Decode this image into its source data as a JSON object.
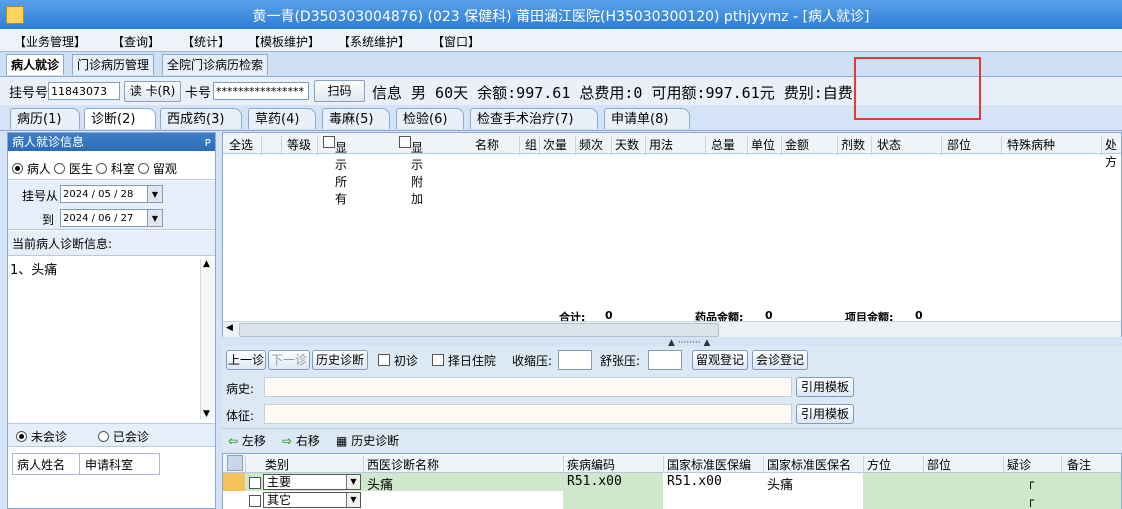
{
  "window": {
    "title": "黄一青(D350303004876) (023 保健科) 莆田涵江医院(H35030300120) pthjyymz - [病人就诊]"
  },
  "menu": [
    "【业务管理】",
    "【查询】",
    "【统计】",
    "【模板维护】",
    "【系统维护】",
    "【窗口】"
  ],
  "page_tabs": [
    "病人就诊",
    "门诊病历管理",
    "全院门诊病历检索"
  ],
  "patient": {
    "reg_label": "挂号号",
    "reg_no": "11843073",
    "read_card_label": "读 卡(R)",
    "card_label": "卡号",
    "card_no": "****************",
    "scan_label": "扫码",
    "info_text": "信息 男 60天 余额:997.61 总费用:0 可用额:997.61元 费别:自费"
  },
  "sub_tabs": [
    "病历(1)",
    "诊断(2)",
    "西成药(3)",
    "草药(4)",
    "毒麻(5)",
    "检验(6)",
    "检查手术治疗(7)",
    "申请单(8)"
  ],
  "left_panel": {
    "title": "病人就诊信息",
    "pin": "ᴘ",
    "radio_options": [
      "病人",
      "医生",
      "科室",
      "留观"
    ],
    "date_from_label": "挂号从",
    "date_from": "2024 / 05 / 28",
    "date_to_label": "到",
    "date_to": "2024 / 06 / 27",
    "current_diag_label": "当前病人诊断信息:",
    "current_diag": "1、头痛",
    "consult_options": [
      "未会诊",
      "已会诊"
    ],
    "consult_table_headers": [
      "病人姓名",
      "申请科室"
    ]
  },
  "order_grid": {
    "headers": [
      "全选",
      "等级",
      "显示所有",
      "显示附加",
      "名称",
      "组",
      "次量",
      "频次",
      "天数",
      "用法",
      "总量",
      "单位",
      "金额",
      "剂数",
      "状态",
      "部位",
      "特殊病种",
      "处方"
    ],
    "total_label": "合计:",
    "total_value": "0",
    "drug_amount_label": "药品金额:",
    "drug_amount_value": "0",
    "item_amount_label": "项目金额:",
    "item_amount_value": "0"
  },
  "diag_toolbar": {
    "prev": "上一诊",
    "next": "下一诊",
    "history": "历史诊断",
    "first_visit": "初诊",
    "select_day_hosp": "择日住院",
    "systolic_label": "收缩压:",
    "diastolic_label": "舒张压:",
    "observe_reg": "留观登记",
    "consult_reg": "会诊登记"
  },
  "history_label": "病史:",
  "sign_label": "体征:",
  "cite_template": "引用模板",
  "diag_actions": {
    "move_left": "左移",
    "move_right": "右移",
    "history_diag": "历史诊断"
  },
  "diag_grid": {
    "headers": [
      "类别",
      "西医诊断名称",
      "疾病编码",
      "国家标准医保编",
      "国家标准医保名",
      "方位",
      "部位",
      "疑诊",
      "备注"
    ],
    "rows": [
      {
        "type": "主要",
        "name": "头痛",
        "code": "R51.x00",
        "std_code": "R51.x00",
        "std_name": "头痛"
      },
      {
        "type": "其它",
        "name": "",
        "code": "",
        "std_code": "",
        "std_name": ""
      }
    ]
  },
  "colors": {
    "titlebar": "#2d7fd6",
    "panel_header": "#2d6cb8",
    "highlight": "#e53935",
    "row_green": "#cfe8cc"
  }
}
